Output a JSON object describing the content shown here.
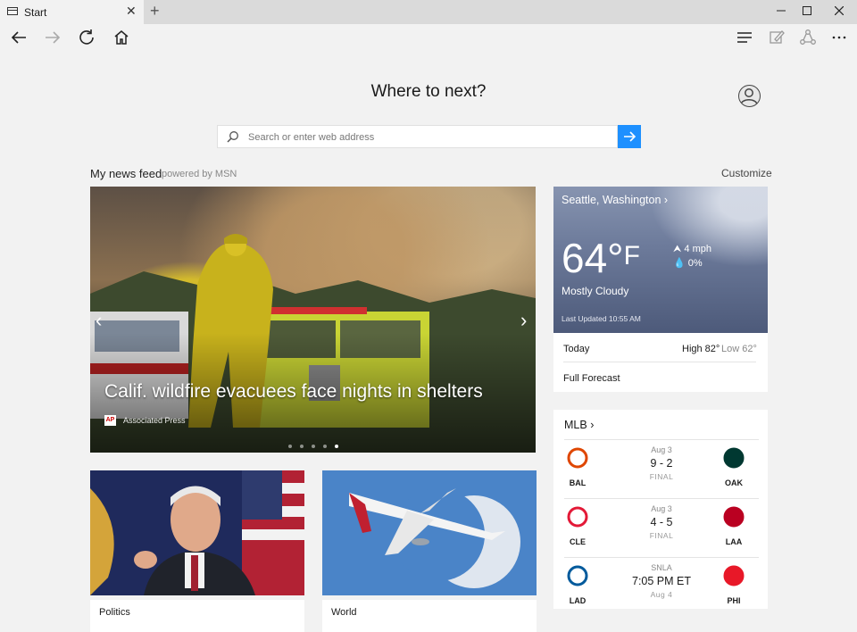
{
  "tab": {
    "title": "Start"
  },
  "heading": "Where to next?",
  "search": {
    "placeholder": "Search or enter web address"
  },
  "feed": {
    "title": "My news feed",
    "powered_by": "powered by MSN",
    "customize": "Customize"
  },
  "hero": {
    "headline": "Calif. wildfire evacuees face nights in shelters",
    "source_logo": "AP",
    "source": "Associated Press",
    "slide_count": 5,
    "active_slide": 5
  },
  "cards": [
    {
      "label": "Politics"
    },
    {
      "label": "World"
    }
  ],
  "weather": {
    "location": "Seattle, Washington",
    "temperature": "64°",
    "unit": "F",
    "wind": "4 mph",
    "precipitation": "0%",
    "condition": "Mostly Cloudy",
    "updated": "Last Updated 10:55 AM",
    "today_label": "Today",
    "high": "High 82°",
    "low": "Low 62°",
    "forecast_link": "Full Forecast"
  },
  "mlb": {
    "title": "MLB",
    "games": [
      {
        "date": "Aug 3",
        "score": "9 - 2",
        "status": "FINAL",
        "home_abbr": "BAL",
        "away_abbr": "OAK",
        "home_color": "#df4601",
        "away_color": "#003831"
      },
      {
        "date": "Aug 3",
        "score": "4 - 5",
        "status": "FINAL",
        "home_abbr": "CLE",
        "away_abbr": "LAA",
        "home_color": "#e31937",
        "away_color": "#ba0021"
      },
      {
        "date": "SNLA",
        "score": "7:05 PM ET",
        "status": "Aug 4",
        "home_abbr": "LAD",
        "away_abbr": "PHI",
        "home_color": "#005a9c",
        "away_color": "#e81828"
      }
    ]
  },
  "colors": {
    "accent": "#1e90ff",
    "background": "#f2f2f2"
  }
}
